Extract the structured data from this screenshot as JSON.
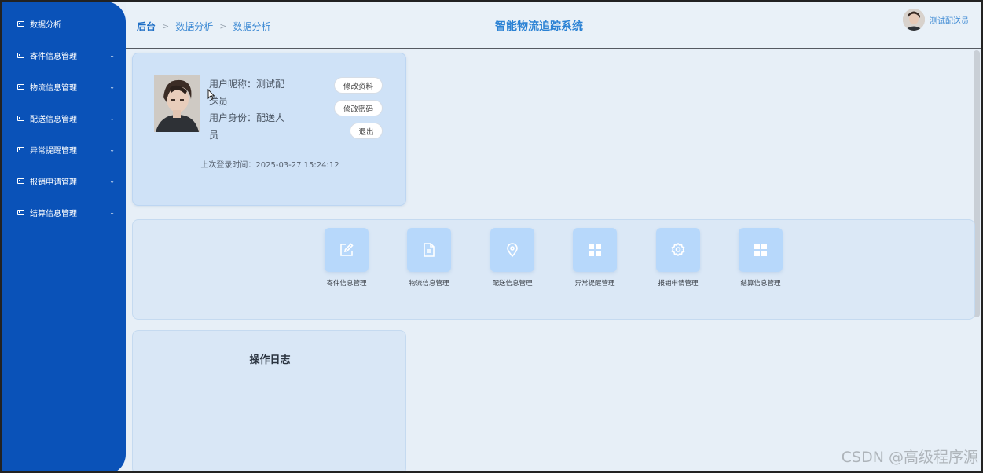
{
  "sidebar": {
    "items": [
      {
        "label": "数据分析",
        "has_arrow": false
      },
      {
        "label": "寄件信息管理",
        "has_arrow": true
      },
      {
        "label": "物流信息管理",
        "has_arrow": true
      },
      {
        "label": "配送信息管理",
        "has_arrow": true
      },
      {
        "label": "异常提醒管理",
        "has_arrow": true
      },
      {
        "label": "报销申请管理",
        "has_arrow": true
      },
      {
        "label": "结算信息管理",
        "has_arrow": true
      }
    ]
  },
  "header": {
    "breadcrumbs": [
      "后台",
      "数据分析",
      "数据分析"
    ],
    "title": "智能物流追踪系统",
    "user_name": "测试配送员"
  },
  "profile": {
    "nickname_line1": "用户昵称：测试配",
    "nickname_line2": "送员",
    "role_line1": "用户身份：配送人",
    "role_line2": "员",
    "buttons": {
      "edit": "修改资料",
      "password": "修改密码",
      "logout": "退出"
    },
    "last_login": "上次登录时间：2025-03-27 15:24:12"
  },
  "quick_menu": [
    {
      "label": "寄件信息管理",
      "icon": "edit-icon"
    },
    {
      "label": "物流信息管理",
      "icon": "document-icon"
    },
    {
      "label": "配送信息管理",
      "icon": "location-pin-icon"
    },
    {
      "label": "异常提醒管理",
      "icon": "grid-icon"
    },
    {
      "label": "报销申请管理",
      "icon": "gear-icon"
    },
    {
      "label": "结算信息管理",
      "icon": "grid-icon"
    }
  ],
  "log": {
    "title": "操作日志"
  },
  "watermark": "CSDN @高级程序源",
  "colors": {
    "sidebar": "#0a52b8",
    "accent": "#2b82d4",
    "quick_icon_bg": "#b7d8fb"
  }
}
